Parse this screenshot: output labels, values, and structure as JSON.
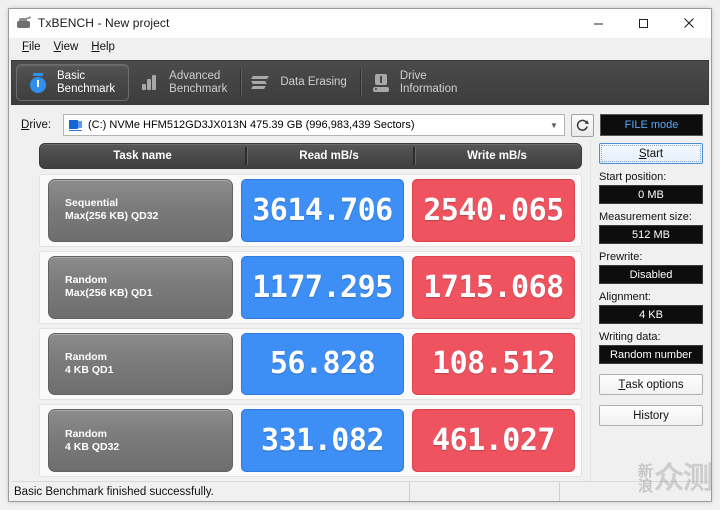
{
  "window": {
    "title": "TxBENCH - New project",
    "icon": "app-icon",
    "controls": {
      "minimize": "minimize-icon",
      "maximize": "maximize-icon",
      "close": "close-icon"
    }
  },
  "menu": {
    "items": [
      {
        "label": "File",
        "mnemonic": "F"
      },
      {
        "label": "View",
        "mnemonic": "V"
      },
      {
        "label": "Help",
        "mnemonic": "H"
      }
    ]
  },
  "toolbar": {
    "tabs": [
      {
        "label": "Basic\nBenchmark",
        "icon": "stopwatch-icon",
        "active": true
      },
      {
        "label": "Advanced\nBenchmark",
        "icon": "bar-chart-icon",
        "active": false
      },
      {
        "label": "Data Erasing",
        "icon": "erase-icon",
        "active": false
      },
      {
        "label": "Drive\nInformation",
        "icon": "drive-info-icon",
        "active": false
      }
    ]
  },
  "drive": {
    "label": "Drive:",
    "mnemonic": "D",
    "selected": "(C:) NVMe HFM512GD3JX013N  475.39 GB (996,983,439 Sectors)",
    "dropdown_icon": "chevron-down-icon",
    "refresh_icon": "refresh-icon",
    "mode_button": "FILE mode"
  },
  "table": {
    "headers": {
      "task": "Task name",
      "read": "Read mB/s",
      "write": "Write mB/s"
    },
    "rows": [
      {
        "task_line1": "Sequential",
        "task_line2": "Max(256 KB) QD32",
        "read": "3614.706",
        "write": "2540.065"
      },
      {
        "task_line1": "Random",
        "task_line2": "Max(256 KB) QD1",
        "read": "1177.295",
        "write": "1715.068"
      },
      {
        "task_line1": "Random",
        "task_line2": "4 KB QD1",
        "read": "56.828",
        "write": "108.512"
      },
      {
        "task_line1": "Random",
        "task_line2": "4 KB QD32",
        "read": "331.082",
        "write": "461.027"
      }
    ]
  },
  "sidebar": {
    "start_button": "Start",
    "start_mnemonic": "S",
    "fields": [
      {
        "label": "Start position:",
        "value": "0 MB"
      },
      {
        "label": "Measurement size:",
        "value": "512 MB"
      },
      {
        "label": "Prewrite:",
        "value": "Disabled"
      },
      {
        "label": "Alignment:",
        "value": "4 KB"
      },
      {
        "label": "Writing data:",
        "value": "Random number"
      }
    ],
    "task_options_button": "Task options",
    "task_options_mnemonic": "T",
    "history_button": "History"
  },
  "status": {
    "message": "Basic Benchmark finished successfully."
  },
  "watermark": {
    "char_top": "新",
    "char_bottom": "浪",
    "text_big": "众测"
  },
  "colors": {
    "read_blue": "#3d8ef5",
    "write_red": "#ef5360",
    "toolbar_dark": "#434343",
    "accent_blue": "#2f90ef",
    "mode_text": "#5ba7ff"
  }
}
